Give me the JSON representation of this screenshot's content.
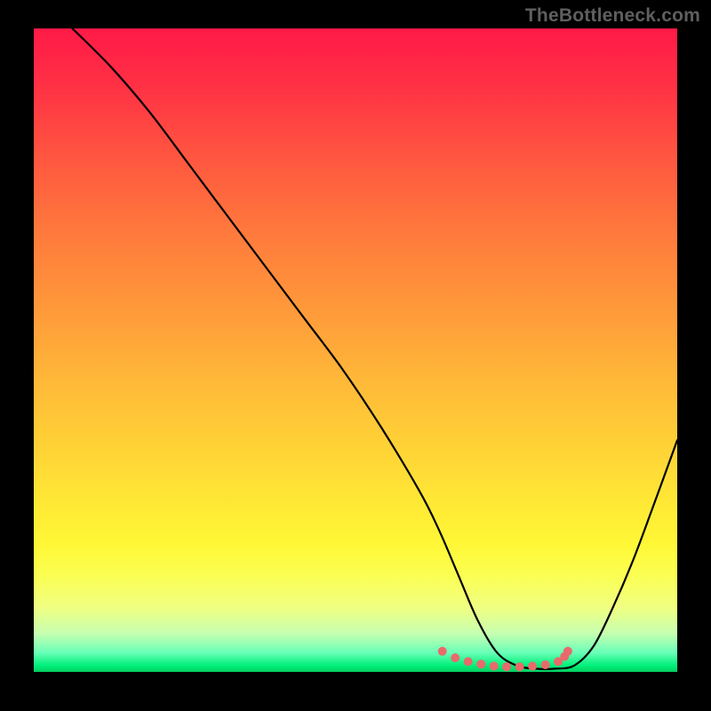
{
  "watermark": "TheBottleneck.com",
  "chart_data": {
    "type": "line",
    "title": "",
    "xlabel": "",
    "ylabel": "",
    "xlim": [
      0,
      100
    ],
    "ylim": [
      0,
      100
    ],
    "grid": false,
    "legend": false,
    "series": [
      {
        "name": "curve",
        "x": [
          6,
          12,
          18,
          24,
          30,
          36,
          42,
          48,
          54,
          60,
          63,
          66,
          69,
          72,
          75,
          78,
          81,
          84,
          87,
          90,
          93,
          96,
          100
        ],
        "y": [
          100,
          94,
          87,
          79,
          71,
          63,
          55,
          47,
          38,
          28,
          22,
          15,
          8,
          3,
          1,
          0.5,
          0.5,
          1,
          4,
          10,
          17,
          25,
          36
        ]
      }
    ],
    "markers": {
      "name": "optimum-zone",
      "x": [
        63.5,
        65.5,
        67.5,
        69.5,
        71.5,
        73.5,
        75.5,
        77.5,
        79.5,
        81.5,
        82.5,
        83.0
      ],
      "y": [
        3.2,
        2.2,
        1.6,
        1.2,
        0.9,
        0.8,
        0.8,
        0.9,
        1.1,
        1.6,
        2.4,
        3.2
      ]
    },
    "gradient_colors": {
      "top": "#ff1a46",
      "bottom": "#00d060"
    }
  }
}
